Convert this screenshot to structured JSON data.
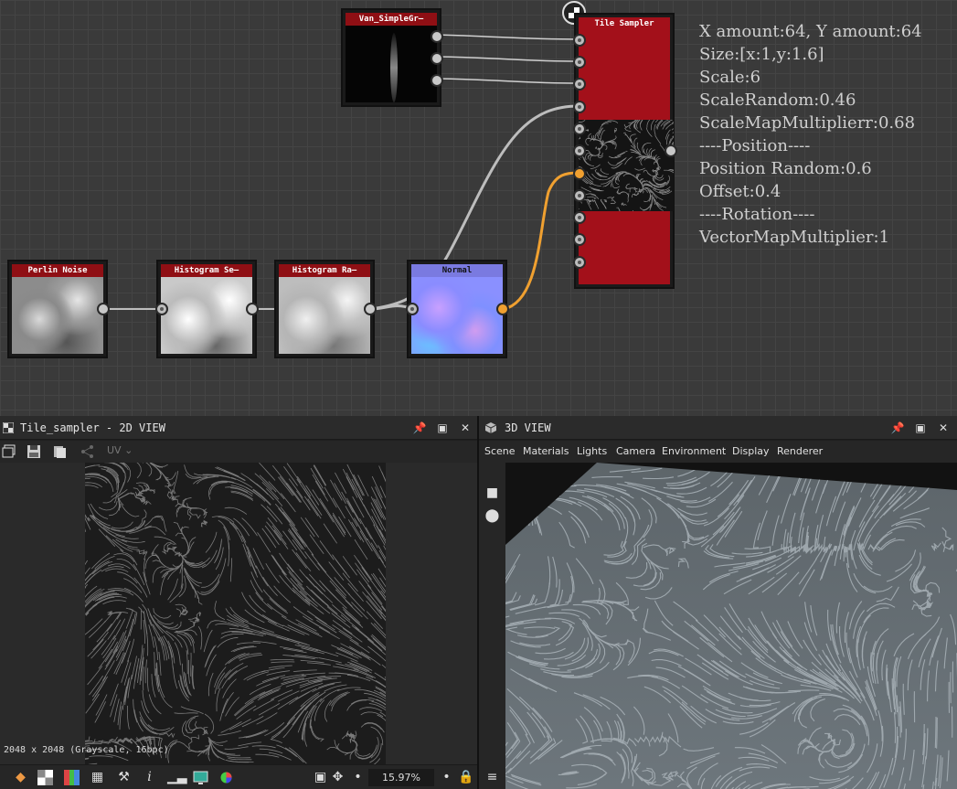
{
  "graph": {
    "nodes": {
      "perlin_noise": "Perlin Noise",
      "histogram_scan": "Histogram Se—",
      "histogram_range": "Histogram Ra—",
      "normal": "Normal",
      "simple_gradient": "Van_SimpleGr—",
      "tile_sampler": "Tile Sampler"
    },
    "params": [
      "X amount:64, Y amount:64",
      "Size:[x:1,y:1.6]",
      "Scale:6",
      "ScaleRandom:0.46",
      "ScaleMapMultiplierr:0.68",
      "----Position----",
      "Position Random:0.6",
      "Offset:0.4",
      "----Rotation----",
      "VectorMapMultiplier:1"
    ]
  },
  "panel2d": {
    "title": "Tile_sampler - 2D VIEW",
    "resolution": "2048 x 2048 (Grayscale, 16bpc)",
    "zoom": "15.97%",
    "uv_label": "UV"
  },
  "panel3d": {
    "title": "3D VIEW",
    "menu": [
      "Scene",
      "Materials",
      "Lights",
      "Camera",
      "Environment",
      "Display",
      "Renderer"
    ]
  },
  "colors": {
    "node_title": "#8f0f14",
    "tile_sampler_body": "#a3101a",
    "orange_port": "#f0a030"
  }
}
